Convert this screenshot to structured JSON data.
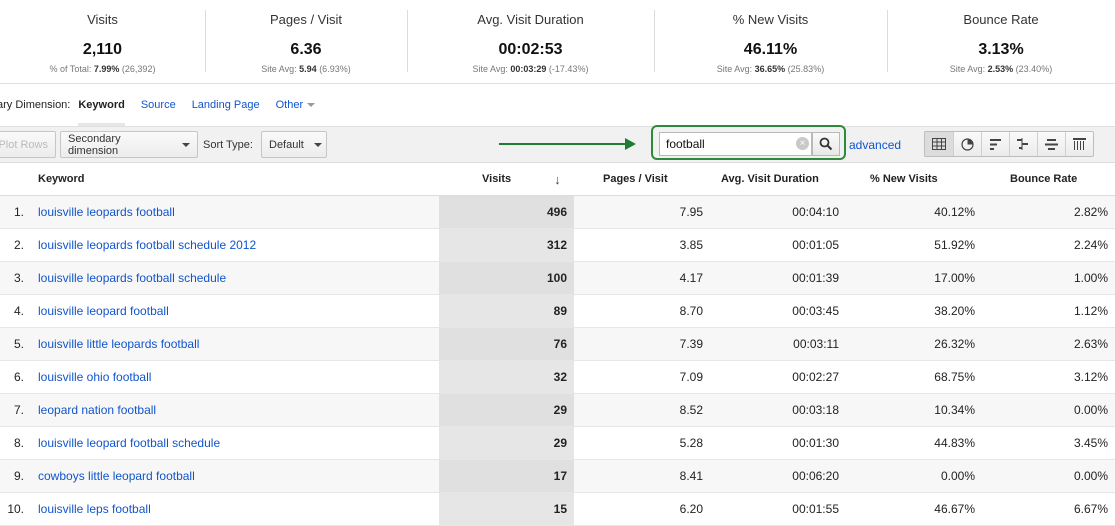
{
  "summary": [
    {
      "label": "Visits",
      "value": "2,110",
      "sub_prefix": "% of Total: ",
      "sub_bold": "7.99%",
      "sub_suffix": " (26,392)"
    },
    {
      "label": "Pages / Visit",
      "value": "6.36",
      "sub_prefix": "Site Avg: ",
      "sub_bold": "5.94",
      "sub_suffix": " (6.93%)"
    },
    {
      "label": "Avg. Visit Duration",
      "value": "00:02:53",
      "sub_prefix": "Site Avg: ",
      "sub_bold": "00:03:29",
      "sub_suffix": " (-17.43%)"
    },
    {
      "label": "% New Visits",
      "value": "46.11%",
      "sub_prefix": "Site Avg: ",
      "sub_bold": "36.65%",
      "sub_suffix": " (25.83%)"
    },
    {
      "label": "Bounce Rate",
      "value": "3.13%",
      "sub_prefix": "Site Avg: ",
      "sub_bold": "2.53%",
      "sub_suffix": " (23.40%)"
    }
  ],
  "dimension_bar": {
    "label": "ary Dimension:",
    "active": "Keyword",
    "links": [
      "Source",
      "Landing Page"
    ],
    "other": "Other"
  },
  "toolbar": {
    "plot_rows": "Plot Rows",
    "secondary_dimension": "Secondary dimension",
    "sort_type_label": "Sort Type:",
    "sort_type_value": "Default",
    "search_value": "football",
    "clear_label": "×",
    "advanced": "advanced",
    "view_icons": [
      "table-view-icon",
      "pie-view-icon",
      "performance-view-icon",
      "comparison-view-icon",
      "term-cloud-view-icon",
      "pivot-view-icon"
    ]
  },
  "table": {
    "headers": {
      "keyword": "Keyword",
      "visits": "Visits",
      "sort_arrow": "↓",
      "pages_visit": "Pages / Visit",
      "duration": "Avg. Visit Duration",
      "new_visits": "% New Visits",
      "bounce": "Bounce Rate"
    },
    "rows": [
      {
        "idx": "1.",
        "keyword": "louisville leopards football",
        "visits": "496",
        "pv": "7.95",
        "dur": "00:04:10",
        "new": "40.12%",
        "br": "2.82%"
      },
      {
        "idx": "2.",
        "keyword": "louisville leopards football schedule 2012",
        "visits": "312",
        "pv": "3.85",
        "dur": "00:01:05",
        "new": "51.92%",
        "br": "2.24%"
      },
      {
        "idx": "3.",
        "keyword": "louisville leopards football schedule",
        "visits": "100",
        "pv": "4.17",
        "dur": "00:01:39",
        "new": "17.00%",
        "br": "1.00%"
      },
      {
        "idx": "4.",
        "keyword": "louisville leopard football",
        "visits": "89",
        "pv": "8.70",
        "dur": "00:03:45",
        "new": "38.20%",
        "br": "1.12%"
      },
      {
        "idx": "5.",
        "keyword": "louisville little leopards football",
        "visits": "76",
        "pv": "7.39",
        "dur": "00:03:11",
        "new": "26.32%",
        "br": "2.63%"
      },
      {
        "idx": "6.",
        "keyword": "louisville ohio football",
        "visits": "32",
        "pv": "7.09",
        "dur": "00:02:27",
        "new": "68.75%",
        "br": "3.12%"
      },
      {
        "idx": "7.",
        "keyword": "leopard nation football",
        "visits": "29",
        "pv": "8.52",
        "dur": "00:03:18",
        "new": "10.34%",
        "br": "0.00%"
      },
      {
        "idx": "8.",
        "keyword": "louisville leopard football schedule",
        "visits": "29",
        "pv": "5.28",
        "dur": "00:01:30",
        "new": "44.83%",
        "br": "3.45%"
      },
      {
        "idx": "9.",
        "keyword": "cowboys little leopard football",
        "visits": "17",
        "pv": "8.41",
        "dur": "00:06:20",
        "new": "0.00%",
        "br": "0.00%"
      },
      {
        "idx": "10.",
        "keyword": "louisville leps football",
        "visits": "15",
        "pv": "6.20",
        "dur": "00:01:55",
        "new": "46.67%",
        "br": "6.67%"
      }
    ]
  },
  "colors": {
    "link": "#1155cc",
    "annotation_green": "#2e8b3a"
  }
}
